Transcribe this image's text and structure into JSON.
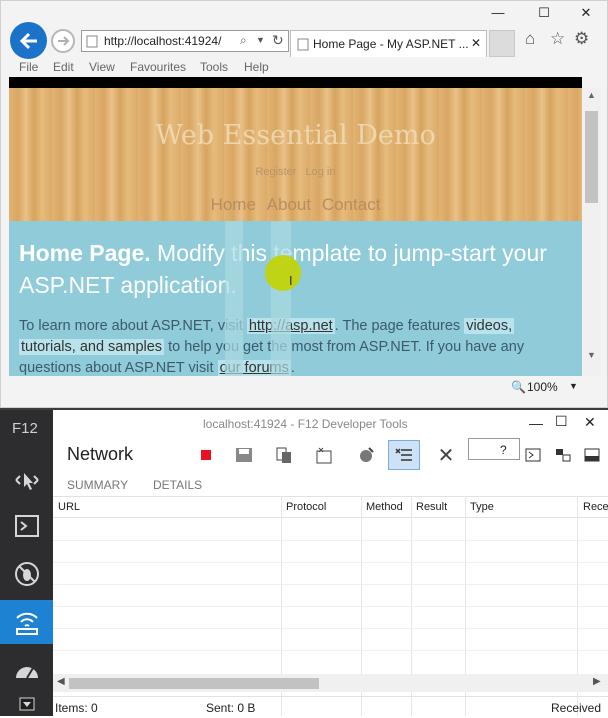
{
  "browser": {
    "url": "http://localhost:41924/",
    "tab_title": "Home Page - My ASP.NET ...",
    "menu": [
      "File",
      "Edit",
      "View",
      "Favourites",
      "Tools",
      "Help"
    ],
    "zoom": "100%",
    "window_controls": {
      "minimize": "—",
      "maximize": "☐",
      "close": "✕"
    }
  },
  "site": {
    "title": "Web Essential Demo",
    "register": "Register",
    "login": "Log in",
    "nav": [
      "Home",
      "About",
      "Contact"
    ],
    "headline_bold": "Home Page.",
    "headline_rest": "Modify this template to jump-start your ASP.NET application.",
    "body_parts": {
      "p1": "To learn more about ASP.NET, visit",
      "link1": "http://asp.net",
      "p2": ". The page features",
      "chip1": "videos,",
      "chip2": "tutorials, and samples",
      "p3": "to help you get the most from ASP.NET. If you have any questions about ASP.NET visit",
      "link2": "our forums",
      "p4": "."
    }
  },
  "devtools": {
    "label": "F12",
    "window_title": "localhost:41924 - F12 Developer Tools",
    "panel_title": "Network",
    "subtabs": [
      "SUMMARY",
      "DETAILS"
    ],
    "columns": [
      "URL",
      "Protocol",
      "Method",
      "Result",
      "Type",
      "Rece"
    ],
    "items": "Items: 0",
    "sent": "Sent: 0 B",
    "received": "Received",
    "help": "?",
    "stop_color": "#e81123"
  }
}
